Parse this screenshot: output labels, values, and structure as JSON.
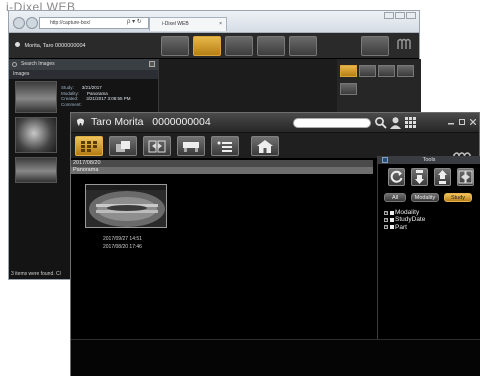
{
  "caption": "i-Dixel WEB",
  "browser": {
    "url": "http://capture-box/",
    "url_tools": "ρ ▾ ↻",
    "tab_title": "i-Dixel WEB",
    "tab_close": "×",
    "patient_title": "Morita, Taro  0000000004",
    "search_images_label": "Search Images",
    "images_label": "Images",
    "study_meta": {
      "study_label": "Study:",
      "study_value": "3/21/2017",
      "modality_label": "Modality:",
      "modality_value": "Panorama",
      "created_label": "Created:",
      "created_value": "3/21/2017 3:08:55 PM",
      "comment_label": "Comment:"
    },
    "status_text": "3 items were found. Cl"
  },
  "app": {
    "patient_name": "Taro Morita",
    "patient_id": "0000000004",
    "logo_text": "MORITA",
    "date_header": "2017/08/20",
    "group_header": "Panorama",
    "image_dates": [
      "2017/09/27  14:51",
      "2017/08/20  17:46"
    ],
    "tools_title": "Tools",
    "filters": [
      {
        "label": "All",
        "active": false
      },
      {
        "label": "Modality",
        "active": false
      },
      {
        "label": "Study",
        "active": true
      }
    ],
    "tree": [
      "Modality",
      "StudyDate",
      "Part"
    ],
    "colors": {
      "accent": "#d89c2a",
      "panel": "#1f1f1f"
    }
  }
}
